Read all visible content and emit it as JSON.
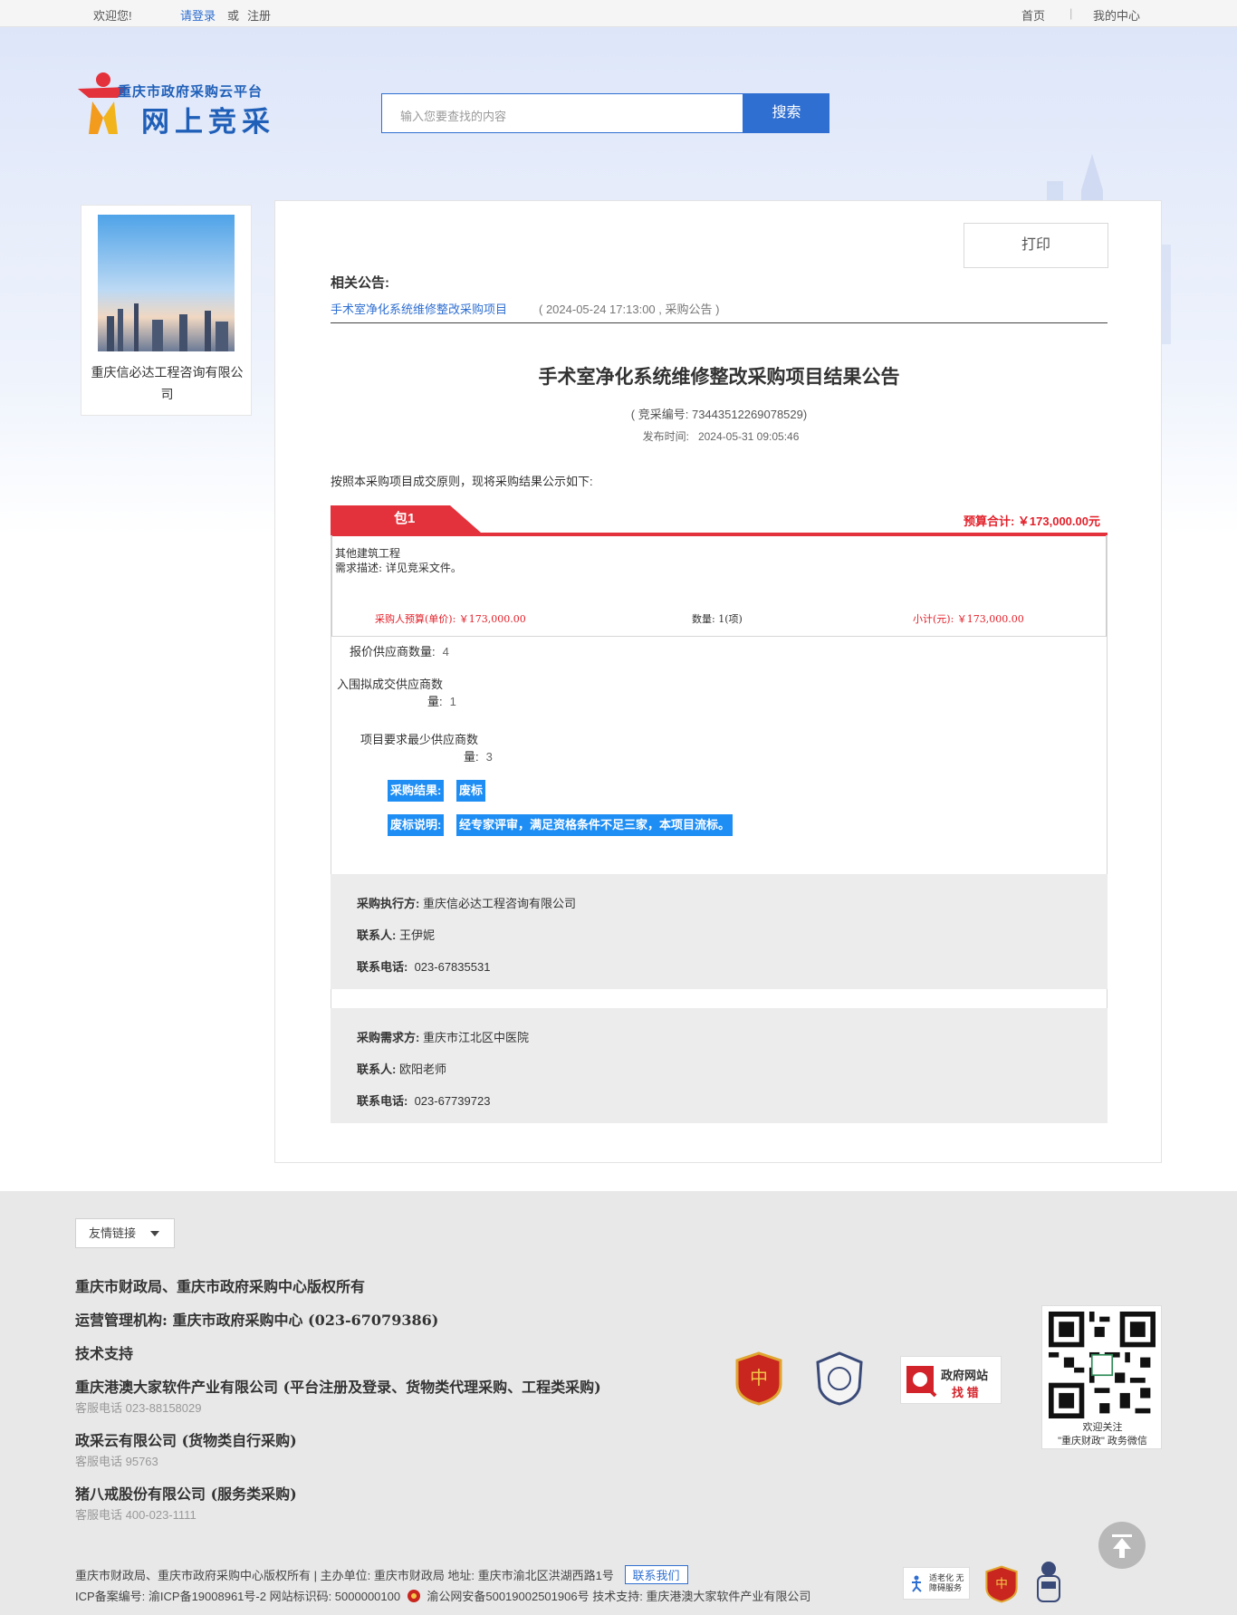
{
  "topbar": {
    "welcome": "欢迎您!",
    "login": "请登录",
    "or": "或",
    "register": "注册",
    "home": "首页",
    "sep": "|",
    "my_center": "我的中心"
  },
  "header": {
    "logo_sub": "重庆市政府采购云平台",
    "logo_main": "网上竞采",
    "search_placeholder": "输入您要查找的内容",
    "search_button": "搜索"
  },
  "sidebar": {
    "company_name": "重庆信必达工程咨询有限公司"
  },
  "main": {
    "print_button": "打印",
    "related_title": "相关公告:",
    "related_link": "手术室净化系统维修整改采购项目",
    "related_meta": "( 2024-05-24 17:13:00 , 采购公告 )",
    "title": "手术室净化系统维修整改采购项目结果公告",
    "code": "( 竞采编号: 734435122690785 29)",
    "code_text": "( 竞采编号: 734435122690785​29)",
    "publish_label": "发布时间:",
    "publish_time": "2024-05-31 09:05:46",
    "intro": "按照本采购项目成交原则，现将采购结果公示如下:",
    "package": {
      "tab": "包1",
      "budget_total": "预算合计: ￥173,000.00元",
      "item_name": "其他建筑工程",
      "item_desc": "需求描述: 详见竞采文件。",
      "unit_price": "采购人预算(单价): ￥173,000.00",
      "quantity": "数量: 1(项)",
      "subtotal": "小计(元): ￥173,000.00",
      "bidders_label": "报价供应商数量:",
      "bidders_value": "4",
      "shortlist_label_1": "入围拟成交供应商数",
      "shortlist_label_2": "量:",
      "shortlist_value": "1",
      "min_label_1": "项目要求最少供应商数",
      "min_label_2": "量:",
      "min_value": "3",
      "result_label": "采购结果:",
      "result_value": "废标",
      "reason_label": "废标说明:",
      "reason_value": "经专家评审，满足资格条件不足三家，本项目流标。"
    },
    "executor": {
      "label": "采购执行方:",
      "value": "重庆信必达工程咨询有限公司",
      "contact_label": "联系人:",
      "contact_value": "王伊妮",
      "phone_label": "联系电话:",
      "phone_value": "023-67835531"
    },
    "demander": {
      "label": "采购需求方:",
      "value": "重庆市江北区中医院",
      "contact_label": "联系人:",
      "contact_value": "欧阳老师",
      "phone_label": "联系电话:",
      "phone_value": "023-67739723"
    }
  },
  "footer": {
    "friend_links": "友情链接",
    "copyright": "重庆市财政局、重庆市政府采购中心版权所有",
    "operator": "运营管理机构: 重庆市政府采购中心 (023-67079386)",
    "tech_support": "技术支持",
    "vendor1": "重庆港澳大家软件产业有限公司 (平台注册及登录、货物类代理采购、工程类采购)",
    "vendor1_phone": "客服电话 023-88158029",
    "vendor2": "政采云有限公司 (货物类自行采购)",
    "vendor2_phone": "客服电话 95763",
    "vendor3": "猪八戒股份有限公司 (服务类采购)",
    "vendor3_phone": "客服电话 400-023-1111",
    "gov_error_1": "政府网站",
    "gov_error_2": "找 错",
    "qr_caption_1": "欢迎关注",
    "qr_caption_2": "\"重庆财政\" 政务微信",
    "bottom_line_1": "重庆市财政局、重庆市政府采购中心版权所有  |  主办单位: 重庆市财政局 地址: 重庆市渝北区洪湖西路1号",
    "contact_us": "联系我们",
    "bottom_line_2": "ICP备案编号: 渝ICP备19008961号-2 网站标识码: 5000000100",
    "bottom_line_3": "渝公网安备50019002501906号 技术支持: 重庆港澳大家软件产业有限公司",
    "elder_badge": "适老化 无障碍服务"
  }
}
